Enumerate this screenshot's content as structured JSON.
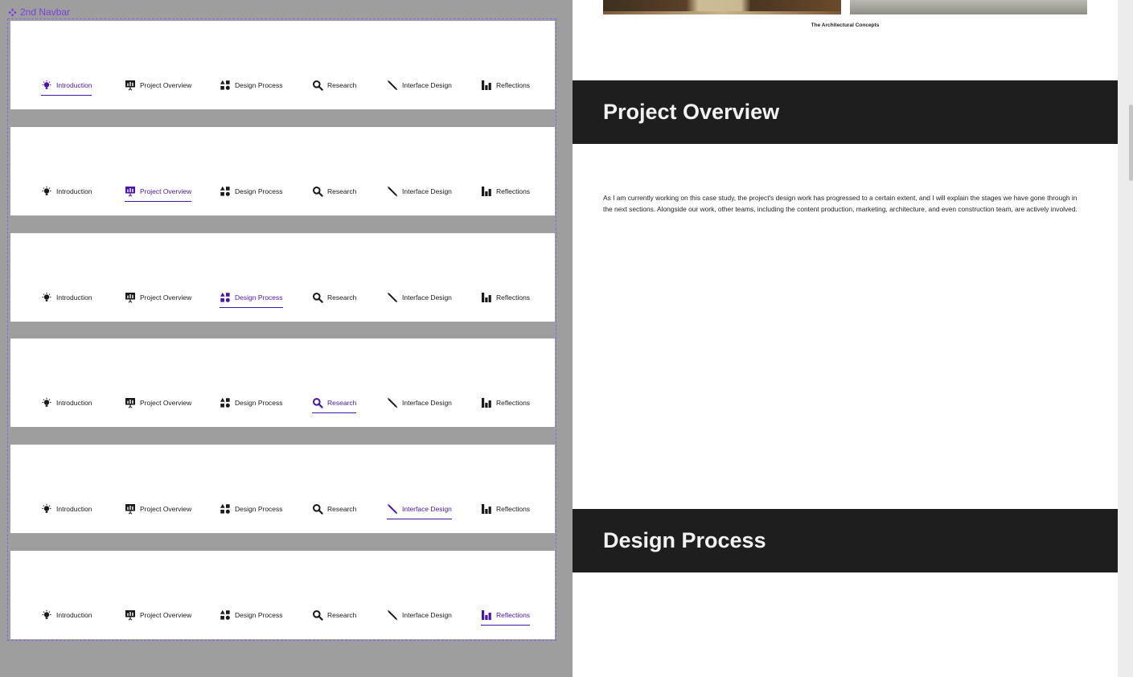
{
  "component": {
    "label": "2nd Navbar",
    "accent_color": "#4a16a6",
    "frame_color": "#8a63e8"
  },
  "nav": {
    "items": [
      {
        "label": "Introduction",
        "icon": "lightbulb-icon"
      },
      {
        "label": "Project Overview",
        "icon": "presentation-chart-icon"
      },
      {
        "label": "Design Process",
        "icon": "shapes-icon"
      },
      {
        "label": "Research",
        "icon": "search-icon"
      },
      {
        "label": "Interface Design",
        "icon": "pen-icon"
      },
      {
        "label": "Reflections",
        "icon": "bar-chart-icon"
      }
    ]
  },
  "variants": [
    {
      "active": 0
    },
    {
      "active": 1
    },
    {
      "active": 2
    },
    {
      "active": 3
    },
    {
      "active": 4
    },
    {
      "active": 5
    }
  ],
  "preview": {
    "caption": "The Architectural Concepts",
    "section1_title": "Project Overview",
    "paragraph": "As I am currently working on this case study, the project's design work has progressed to a certain extent, and I will explain the stages we have gone through in the next sections. Alongside our work, other teams, including the content production, marketing, architecture, and even construction team, are actively involved.",
    "section2_title": "Design Process"
  }
}
